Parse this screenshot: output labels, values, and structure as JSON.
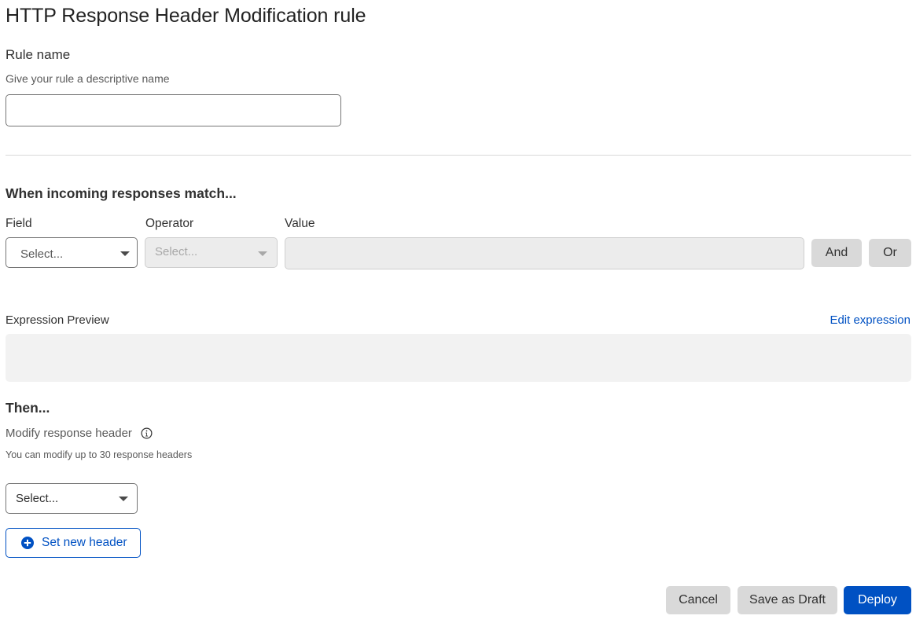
{
  "page": {
    "title": "HTTP Response Header Modification rule"
  },
  "rule_name": {
    "label": "Rule name",
    "help": "Give your rule a descriptive name",
    "value": ""
  },
  "match": {
    "heading": "When incoming responses match...",
    "field": {
      "label": "Field",
      "placeholder": "Select..."
    },
    "operator": {
      "label": "Operator",
      "placeholder": "Select...",
      "disabled": true
    },
    "value": {
      "label": "Value",
      "value": "",
      "disabled": true
    },
    "and_label": "And",
    "or_label": "Or"
  },
  "expression": {
    "label": "Expression Preview",
    "edit_link": "Edit expression",
    "value": ""
  },
  "then": {
    "heading": "Then...",
    "modify_label": "Modify response header",
    "info_icon": "info-icon",
    "help": "You can modify up to 30 response headers",
    "action_select": {
      "placeholder": "Select..."
    },
    "set_new_header_label": "Set new header",
    "set_new_header_icon": "plus-circle-icon"
  },
  "footer": {
    "cancel_label": "Cancel",
    "save_draft_label": "Save as Draft",
    "deploy_label": "Deploy"
  },
  "colors": {
    "primary": "#0051c3",
    "secondary_button": "#d9d9d9",
    "disabled_input": "#ececec",
    "preview_bg": "#f2f2f2"
  }
}
